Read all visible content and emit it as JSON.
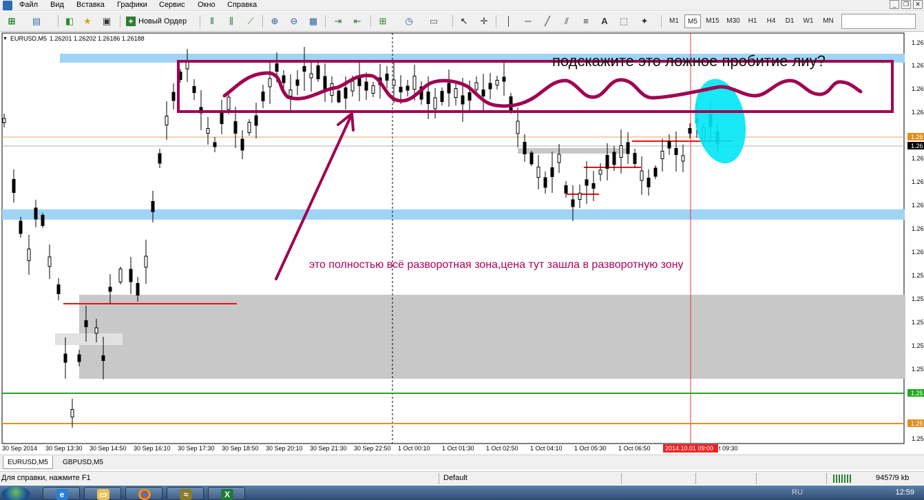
{
  "menu": {
    "items": [
      "Файл",
      "Вид",
      "Вставка",
      "Графики",
      "Сервис",
      "Окно",
      "Справка"
    ]
  },
  "toolbar": {
    "new_order_label": "Новый Ордер",
    "timeframes": [
      "M1",
      "M5",
      "M15",
      "M30",
      "H1",
      "H4",
      "D1",
      "W1",
      "MN"
    ],
    "active_timeframe": "M5"
  },
  "chart": {
    "header_symbol": "EURUSD,M5",
    "header_prices": "1.26201 1.26202 1.26186 1.26188",
    "caption": "подскажите это ложное пробитие лиу?",
    "annotation": "это полностью всё разворотная зона,цена тут зашла в разворотную зону",
    "price_axis_labels": [
      "1.26",
      "1.26",
      "1.26",
      "1.26",
      "1.26",
      "1.26",
      "1.26",
      "1.26",
      "1.26",
      "1.25",
      "1.25",
      "1.25",
      "1.25",
      "1.25",
      "1.25"
    ],
    "price_tags": {
      "orange": "1.26",
      "current": "1.26",
      "green": "1.25",
      "orange_low": "1.25"
    },
    "time_labels": [
      "30 Sep 2014",
      "30 Sep 13:30",
      "30 Sep 14:50",
      "30 Sep 16:10",
      "30 Sep 17:30",
      "30 Sep 18:50",
      "30 Sep 20:10",
      "30 Sep 21:30",
      "30 Sep 22:50",
      "1 Oct 00:10",
      "1 Oct 01:30",
      "1 Oct 02:50",
      "1 Oct 04:10",
      "1 Oct 05:30",
      "1 Oct 06:50"
    ],
    "cursor_time_label": "2014.10.01 09:00",
    "cursor_time_suffix": "t 09:30",
    "colors": {
      "zone_blue": "#9fd4f5",
      "zone_gray": "#c8c8c8",
      "annotation_magenta": "#a00050",
      "highlight_cyan": "#00e5f5",
      "green_line": "#22aa22",
      "orange_line": "#e09020",
      "red_level": "#ee1111"
    }
  },
  "tabs": {
    "items": [
      "EURUSD,M5",
      "GBPUSD,M5"
    ],
    "active": 0
  },
  "status": {
    "help_text": "Для справки, нажмите F1",
    "profile": "Default",
    "traffic": "9457/9 kb"
  },
  "taskbar": {
    "lang": "RU",
    "clock": "12:59"
  }
}
